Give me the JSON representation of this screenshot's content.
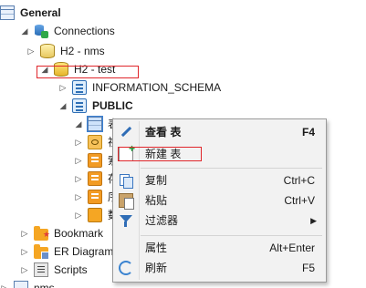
{
  "tree": {
    "root": {
      "label": "General"
    },
    "connections": {
      "label": "Connections"
    },
    "conn_nms": {
      "label": "H2 - nms"
    },
    "conn_test": {
      "label": "H2 - test"
    },
    "info_schema": {
      "label": "INFORMATION_SCHEMA"
    },
    "public": {
      "label": "PUBLIC"
    },
    "tables_folder": {
      "label": "表"
    },
    "child_1": {
      "label": "视"
    },
    "child_2": {
      "label": "索"
    },
    "child_3": {
      "label": "存"
    },
    "child_4": {
      "label": "序"
    },
    "child_5": {
      "label": "数"
    },
    "bookmarks": {
      "label": "Bookmark"
    },
    "er": {
      "label": "ER Diagram"
    },
    "scripts": {
      "label": "Scripts"
    },
    "nms": {
      "label": "nms"
    }
  },
  "context_menu": {
    "items": [
      {
        "label": "查看 表",
        "shortcut": "F4",
        "icon": "pencil-icon"
      },
      {
        "label": "新建 表",
        "shortcut": "",
        "icon": "new-table-icon"
      },
      {
        "label": "复制",
        "shortcut": "Ctrl+C",
        "icon": "copy-icon"
      },
      {
        "label": "粘贴",
        "shortcut": "Ctrl+V",
        "icon": "paste-icon"
      },
      {
        "label": "过滤器",
        "shortcut": "",
        "icon": "filter-icon",
        "submenu": true
      },
      {
        "label": "属性",
        "shortcut": "Alt+Enter",
        "icon": ""
      },
      {
        "label": "刷新",
        "shortcut": "F5",
        "icon": "refresh-icon"
      }
    ]
  },
  "colors": {
    "annotation": "#e0262b",
    "menu_bg": "#f2f2f2",
    "selection": "#cfe3fb"
  }
}
